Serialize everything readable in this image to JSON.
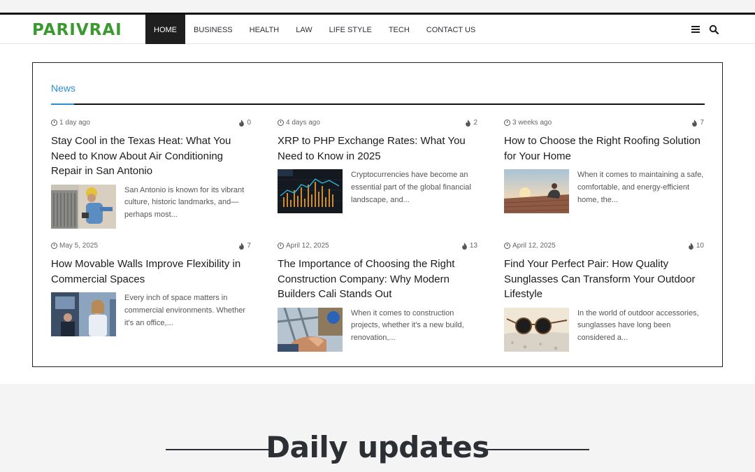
{
  "header": {
    "logo": "PARIVRAI",
    "nav": [
      {
        "label": "HOME",
        "active": true
      },
      {
        "label": "BUSINESS"
      },
      {
        "label": "HEALTH"
      },
      {
        "label": "LAW"
      },
      {
        "label": "LIFE STYLE"
      },
      {
        "label": "TECH"
      },
      {
        "label": "CONTACT US"
      }
    ],
    "icons": [
      "menu-icon",
      "search-icon"
    ]
  },
  "news": {
    "title": "News",
    "accent_color": "#2c8fd6",
    "articles": [
      {
        "date": "1 day ago",
        "views": "0",
        "title": "Stay Cool in the Texas Heat: What You Need to Know About Air Conditioning Repair in San Antonio",
        "excerpt": "San Antonio is known for its vibrant culture, historic landmarks, and—perhaps most..."
      },
      {
        "date": "4 days ago",
        "views": "2",
        "title": "XRP to PHP Exchange Rates: What You Need to Know in 2025",
        "excerpt": "Cryptocurrencies have become an essential part of the global financial landscape, and..."
      },
      {
        "date": "3 weeks ago",
        "views": "7",
        "title": "How to Choose the Right Roofing Solution for Your Home",
        "excerpt": "When it comes to maintaining a safe, comfortable, and energy-efficient home, the..."
      },
      {
        "date": "May 5, 2025",
        "views": "7",
        "title": "How Movable Walls Improve Flexibility in Commercial Spaces",
        "excerpt": "Every inch of space matters in commercial environments. Whether it's an office,..."
      },
      {
        "date": "April 12, 2025",
        "views": "13",
        "title": "The Importance of Choosing the Right Construction Company: Why Modern Builders Cali Stands Out",
        "excerpt": "When it comes to construction projects, whether it's a new build, renovation,..."
      },
      {
        "date": "April 12, 2025",
        "views": "10",
        "title": "Find Your Perfect Pair: How Quality Sunglasses Can Transform Your Outdoor Lifestyle",
        "excerpt": "In the world of outdoor accessories, sunglasses have long been considered a..."
      }
    ]
  },
  "daily": {
    "title": "Daily updates"
  }
}
